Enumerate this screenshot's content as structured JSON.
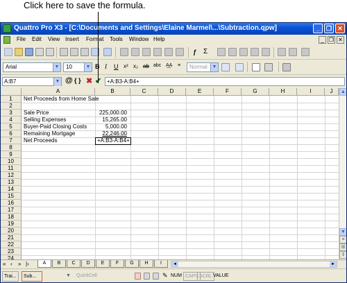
{
  "callout": {
    "text": "Click here to save the formula."
  },
  "window": {
    "title": "Quattro Pro X3 - [C:\\Documents and Settings\\Elaine Marmel\\...\\Subtraction.qpw]"
  },
  "menu": {
    "items": [
      "File",
      "Edit",
      "View",
      "Insert",
      "Format",
      "Tools",
      "Window",
      "Help"
    ]
  },
  "toolbar": {
    "font_name": "Arial",
    "font_size": "10",
    "bold": "B",
    "italic": "I",
    "underline": "U",
    "style": "Normal"
  },
  "formula_bar": {
    "cell_ref": "A:B7",
    "at_label": "@",
    "braces_label": "{ }",
    "cancel_label": "✖",
    "confirm_label": "✔",
    "value": "+A:B3-A:B4+"
  },
  "grid": {
    "columns": [
      "A",
      "B",
      "C",
      "D",
      "E",
      "F",
      "G",
      "H",
      "I",
      "J"
    ],
    "rows": [
      "1",
      "2",
      "3",
      "4",
      "5",
      "6",
      "7",
      "8",
      "9",
      "10",
      "11",
      "12",
      "13",
      "14",
      "15",
      "16",
      "17",
      "18",
      "19",
      "20",
      "21",
      "22",
      "23",
      "24"
    ],
    "cells": {
      "A1": "Net Proceeds from Home Sale",
      "A3": "Sale Price",
      "B3": "225,000.00",
      "A4": "Selling Expenses",
      "B4": "15,265.00",
      "A5": "Buyer-Paid Closing Costs",
      "B5": "5,000.00",
      "A6": "Remaining Mortgage",
      "B6": "22,246.00",
      "A7": "Net Proceeds",
      "B7": "+A:B3-A:B4+"
    }
  },
  "sheet_tabs": {
    "nav": [
      "«",
      "‹",
      "»",
      "|›"
    ],
    "tabs": [
      "A",
      "B",
      "C",
      "D",
      "E",
      "F",
      "G",
      "H",
      "I"
    ]
  },
  "status": {
    "task1": "Trai...",
    "task2": "Sub...",
    "quickcell": "QuickCell",
    "num": "NUM",
    "caps": "CAPS",
    "scrl": "SCRL",
    "mode": "VALUE"
  }
}
